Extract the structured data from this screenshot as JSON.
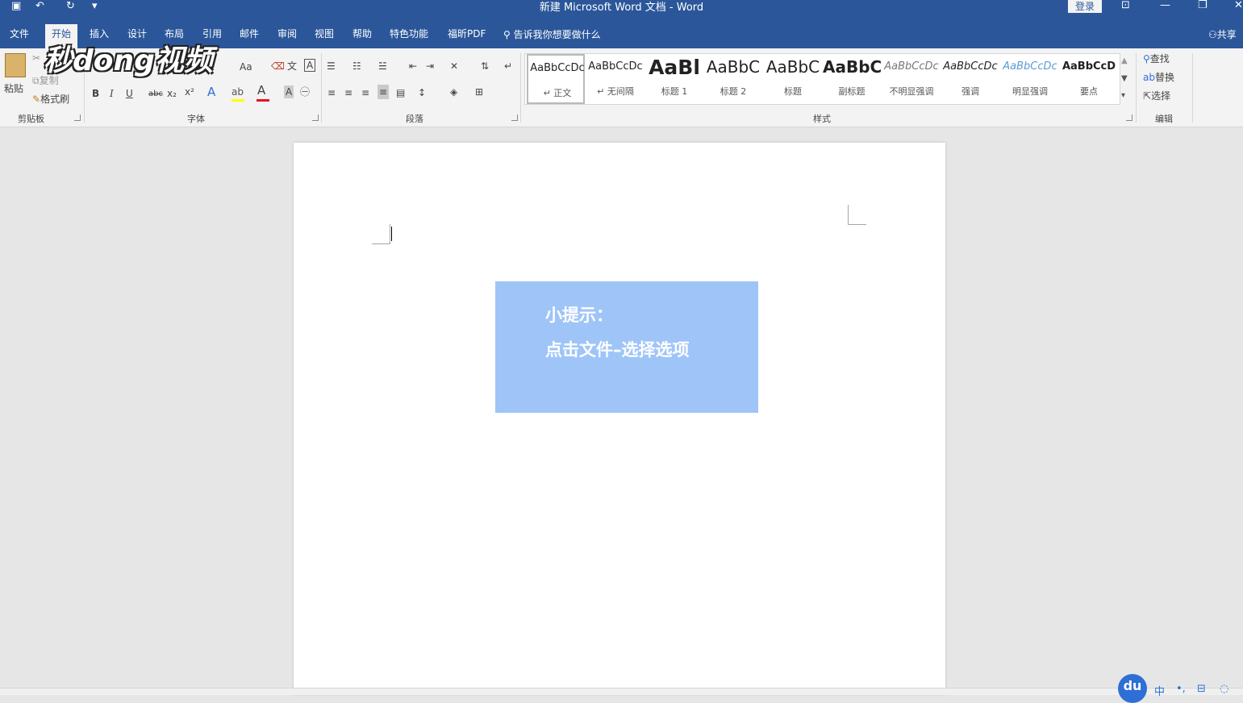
{
  "window": {
    "title": "新建 Microsoft Word 文档 - Word",
    "login": "登录"
  },
  "tabs": [
    "文件",
    "开始",
    "插入",
    "设计",
    "布局",
    "引用",
    "邮件",
    "审阅",
    "视图",
    "帮助",
    "特色功能",
    "福昕PDF"
  ],
  "active_tab": "开始",
  "tell_me": "告诉我你想要做什么",
  "share": "共享",
  "clipboard": {
    "paste": "粘贴",
    "copy": "复制",
    "format_painter": "格式刷",
    "label": "剪贴板"
  },
  "font_group": {
    "case_btn": "Aa",
    "bold": "B",
    "italic": "I",
    "underline": "U",
    "strike": "abc",
    "subscript": "x₂",
    "superscript": "x²",
    "font_color": "A",
    "char_shading": "A",
    "label": "字体"
  },
  "paragraph_group": {
    "label": "段落"
  },
  "styles": {
    "label": "样式",
    "items": [
      {
        "preview": "AaBbCcDc",
        "name": "↵ 正文"
      },
      {
        "preview": "AaBbCcDc",
        "name": "↵ 无间隔"
      },
      {
        "preview": "AaBl",
        "name": "标题 1"
      },
      {
        "preview": "AaBbC",
        "name": "标题 2"
      },
      {
        "preview": "AaBbC",
        "name": "标题"
      },
      {
        "preview": "AaBbC",
        "name": "副标题"
      },
      {
        "preview": "AaBbCcDc",
        "name": "不明显强调"
      },
      {
        "preview": "AaBbCcDc",
        "name": "强调"
      },
      {
        "preview": "AaBbCcDc",
        "name": "明显强调"
      },
      {
        "preview": "AaBbCcD",
        "name": "要点"
      }
    ]
  },
  "editing": {
    "find": "查找",
    "replace": "替换",
    "select": "选择",
    "label": "编辑"
  },
  "tip": {
    "line1": "小提示：",
    "line2": "点击文件–选择选项"
  },
  "watermark": "秒dong视频",
  "badge": "du",
  "ime": "中",
  "colors": {
    "titlebar": "#2b579a",
    "ribbon": "#f3f3f3",
    "tip_box": "#9fc5f8",
    "font_color_bar": "#e81123",
    "highlight_bar": "#ffff00"
  }
}
